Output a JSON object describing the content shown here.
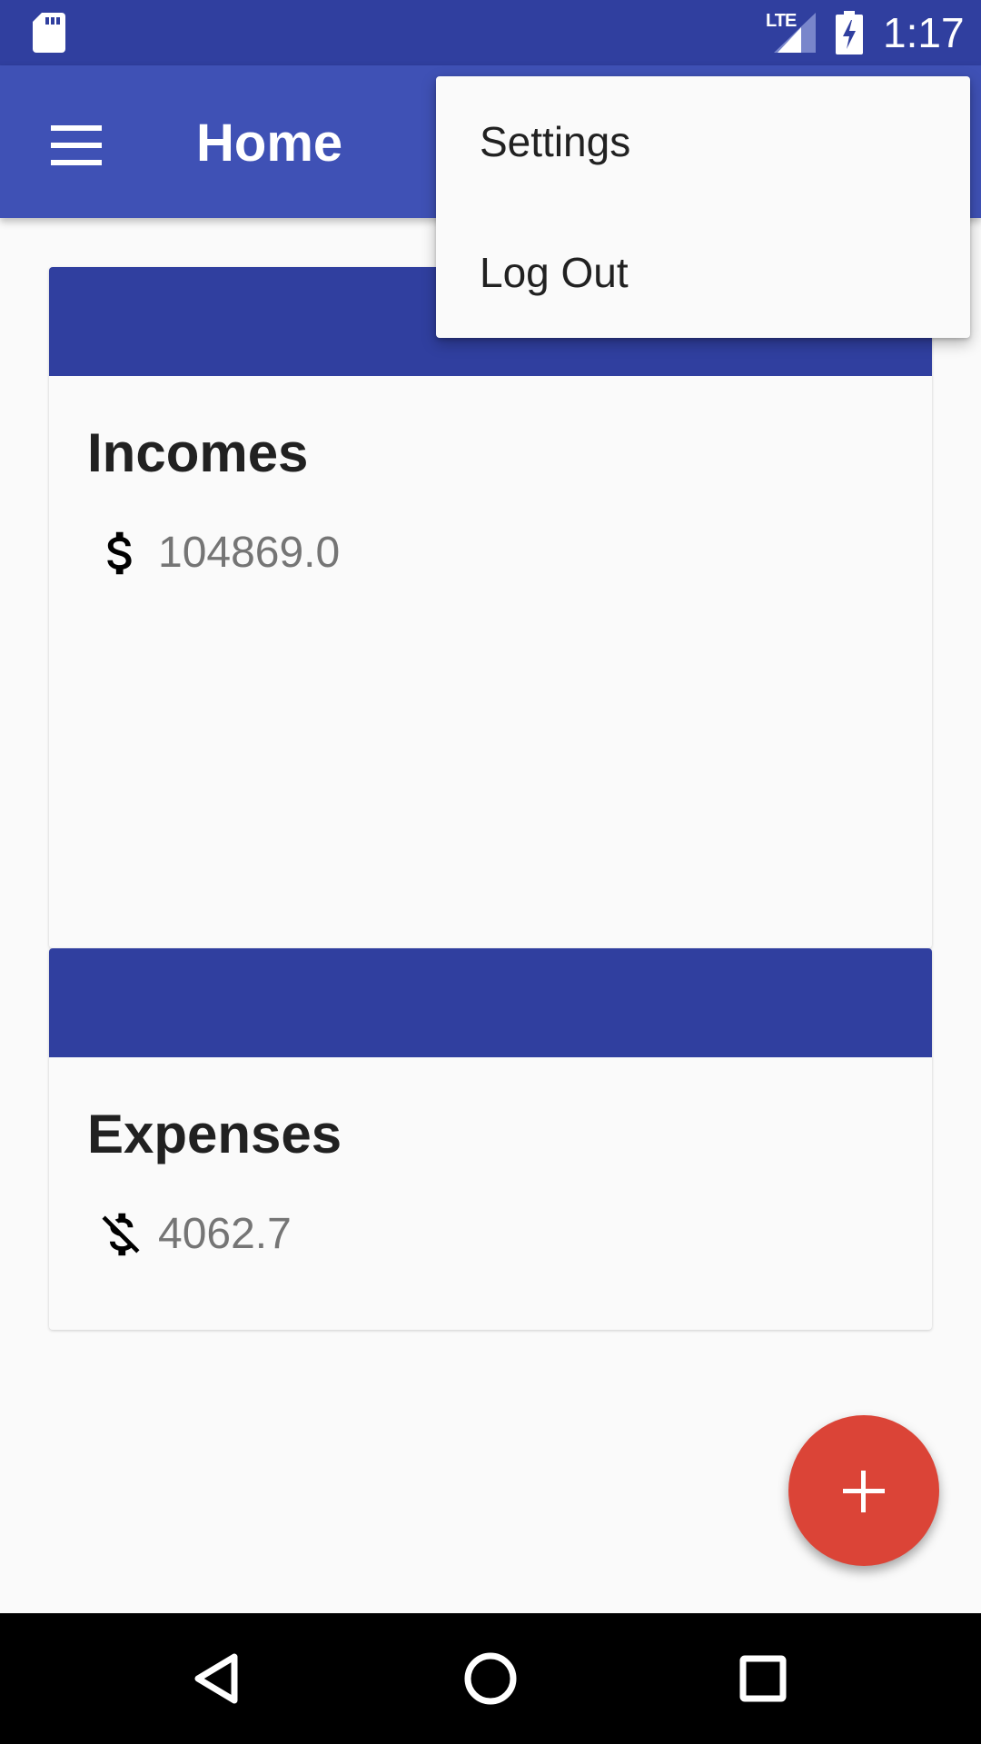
{
  "status_bar": {
    "network_label": "LTE",
    "time": "1:17",
    "icons": [
      "sd-card-icon",
      "signal-icon",
      "battery-charging-icon"
    ]
  },
  "app_bar": {
    "title": "Home",
    "menu_icon": "hamburger-menu-icon"
  },
  "overflow_menu": {
    "items": [
      {
        "label": "Settings"
      },
      {
        "label": "Log Out"
      }
    ]
  },
  "cards": [
    {
      "title": "Incomes",
      "icon": "dollar-icon",
      "amount": "104869.0"
    },
    {
      "title": "Expenses",
      "icon": "dollar-off-icon",
      "amount": "4062.7"
    }
  ],
  "fab": {
    "icon": "plus-icon"
  },
  "nav_bar": {
    "buttons": [
      "back-icon",
      "home-icon",
      "recents-icon"
    ]
  },
  "colors": {
    "primary": "#3f51b5",
    "primary_dark": "#303f9f",
    "accent": "#db4437",
    "background": "#fafafa"
  }
}
